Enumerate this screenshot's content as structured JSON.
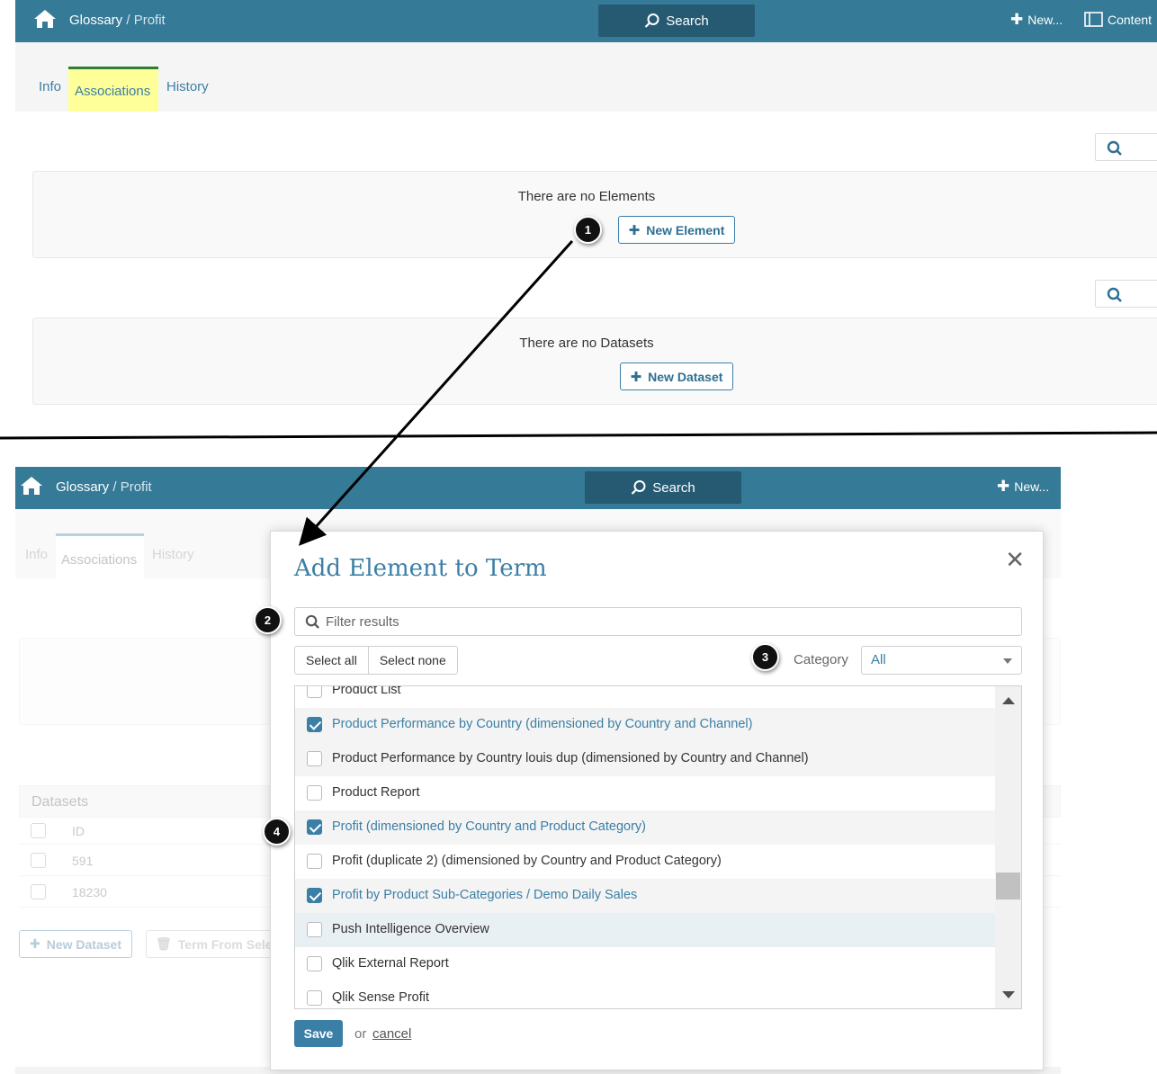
{
  "top": {
    "breadcrumb_root": "Glossary",
    "breadcrumb_sep": "/",
    "breadcrumb_leaf": "Profit",
    "search_label": "Search",
    "new_label": "New...",
    "content_label": "Content",
    "tabs": [
      "Info",
      "Associations",
      "History"
    ],
    "elements_empty": "There are no Elements",
    "new_element_label": "New Element",
    "datasets_empty": "There are no Datasets",
    "new_dataset_label": "New Dataset"
  },
  "bottom": {
    "breadcrumb_root": "Glossary",
    "breadcrumb_sep": "/",
    "breadcrumb_leaf": "Profit",
    "search_label": "Search",
    "new_label": "New...",
    "tabs": [
      "Info",
      "Associations",
      "History"
    ],
    "datasets_header": "Datasets",
    "table_col_id": "ID",
    "table_rows": [
      "591",
      "18230"
    ],
    "new_dataset_label": "New Dataset",
    "term_from_selection_label": "Term From Sele"
  },
  "modal": {
    "title": "Add Element to Term",
    "filter_placeholder": "Filter results",
    "select_all": "Select all",
    "select_none": "Select none",
    "category_label": "Category",
    "category_value": "All",
    "items": [
      {
        "label": "Product List",
        "checked": false
      },
      {
        "label": "Product Performance by Country (dimensioned by Country and Channel)",
        "checked": true
      },
      {
        "label": "Product Performance by Country louis dup (dimensioned by Country and Channel)",
        "checked": false
      },
      {
        "label": "Product Report",
        "checked": false
      },
      {
        "label": "Profit (dimensioned by Country and Product Category)",
        "checked": true
      },
      {
        "label": "Profit (duplicate 2) (dimensioned by Country and Product Category)",
        "checked": false
      },
      {
        "label": "Profit by Product Sub-Categories / Demo Daily Sales",
        "checked": true
      },
      {
        "label": "Push Intelligence Overview",
        "checked": false
      },
      {
        "label": "Qlik External Report",
        "checked": false
      },
      {
        "label": "Qlik Sense Profit",
        "checked": false
      }
    ],
    "save_label": "Save",
    "or_label": "or",
    "cancel_label": "cancel"
  },
  "callouts": [
    "1",
    "2",
    "3",
    "4"
  ],
  "colors": {
    "header": "#357a96",
    "accent": "#3b7fa6",
    "highlight_tab": "#ffff99"
  }
}
